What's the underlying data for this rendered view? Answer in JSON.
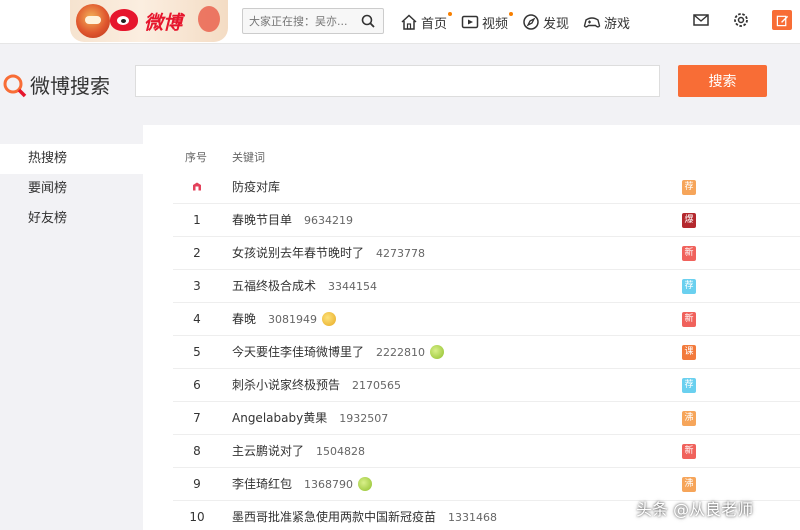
{
  "nav": {
    "logo_text": "微博",
    "search_placeholder": "大家正在搜：吴亦...",
    "items": [
      {
        "label": "首页",
        "icon": "home-icon",
        "dot": true
      },
      {
        "label": "视频",
        "icon": "video-icon",
        "dot": true
      },
      {
        "label": "发现",
        "icon": "discover-icon",
        "dot": false
      },
      {
        "label": "游戏",
        "icon": "game-icon",
        "dot": false
      }
    ],
    "right_icons": [
      "mail-icon",
      "gear-icon",
      "compose-icon"
    ]
  },
  "search": {
    "title": "微博搜索",
    "value": "",
    "button_label": "搜索"
  },
  "sidebar": {
    "items": [
      {
        "label": "热搜榜",
        "active": true
      },
      {
        "label": "要闻榜",
        "active": false
      },
      {
        "label": "好友榜",
        "active": false
      }
    ]
  },
  "list": {
    "head_rank": "序号",
    "head_keyword": "关键词",
    "rows": [
      {
        "rank": "",
        "pinned": true,
        "keyword": "防疫对库",
        "count": "",
        "emoji": "",
        "badge": "荐",
        "badge_color": "#f6a55a"
      },
      {
        "rank": "1",
        "pinned": false,
        "keyword": "春晚节目单",
        "count": "9634219",
        "emoji": "",
        "badge": "爆",
        "badge_color": "#b4292e"
      },
      {
        "rank": "2",
        "pinned": false,
        "keyword": "女孩说别去年春节晚时了",
        "count": "4273778",
        "emoji": "",
        "badge": "新",
        "badge_color": "#f0625c"
      },
      {
        "rank": "3",
        "pinned": false,
        "keyword": "五福终极合成术",
        "count": "3344154",
        "emoji": "",
        "badge": "荐",
        "badge_color": "#6ad0ef"
      },
      {
        "rank": "4",
        "pinned": false,
        "keyword": "春晚",
        "count": "3081949",
        "emoji": "gold",
        "badge": "新",
        "badge_color": "#f0625c"
      },
      {
        "rank": "5",
        "pinned": false,
        "keyword": "今天要住李佳琦微博里了",
        "count": "2222810",
        "emoji": "green",
        "badge": "课",
        "badge_color": "#f27a3c"
      },
      {
        "rank": "6",
        "pinned": false,
        "keyword": "刺杀小说家终极预告",
        "count": "2170565",
        "emoji": "",
        "badge": "荐",
        "badge_color": "#6ad0ef"
      },
      {
        "rank": "7",
        "pinned": false,
        "keyword": "Angelababy黄果",
        "count": "1932507",
        "emoji": "",
        "badge": "沸",
        "badge_color": "#f6a55a"
      },
      {
        "rank": "8",
        "pinned": false,
        "keyword": "主云鹏说对了",
        "count": "1504828",
        "emoji": "",
        "badge": "新",
        "badge_color": "#f0625c"
      },
      {
        "rank": "9",
        "pinned": false,
        "keyword": "李佳琦红包",
        "count": "1368790",
        "emoji": "green",
        "badge": "沸",
        "badge_color": "#f6a55a"
      },
      {
        "rank": "10",
        "pinned": false,
        "keyword": "墨西哥批准紧急使用两款中国新冠疫苗",
        "count": "1331468",
        "emoji": "",
        "badge": "",
        "badge_color": ""
      }
    ]
  },
  "watermark": "头条 @从良老师",
  "colors": {
    "accent": "#f86d36",
    "brand_red": "#e6162d"
  }
}
